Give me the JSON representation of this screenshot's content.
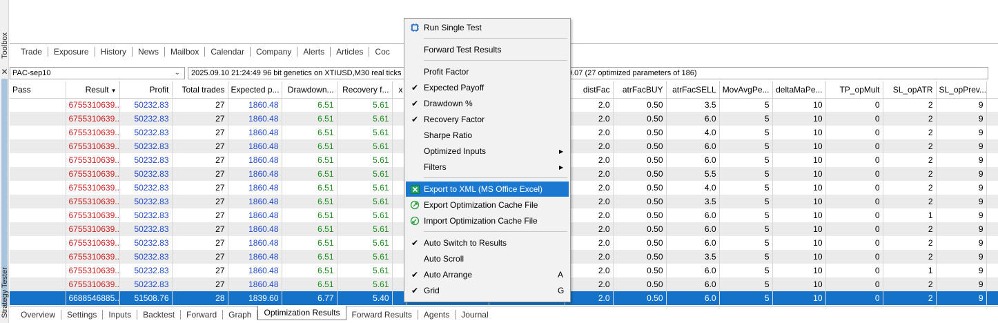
{
  "sidebar": {
    "toolbox_label": "Toolbox",
    "tester_label": "Strategy Tester",
    "close_symbol": "✕"
  },
  "toolbox_tabs": [
    "Trade",
    "Exposure",
    "History",
    "News",
    "Mailbox",
    "Calendar",
    "Company",
    "Alerts",
    "Articles",
    "Coc"
  ],
  "toolbar": {
    "profile": "PAC-sep10",
    "info": "2025.09.10 21:24:49   96 bit genetics  on XTIUSD,M30 real ticks",
    "info_right": "9.07  (27 optimized parameters of 186)"
  },
  "grid": {
    "headers": [
      "Pass",
      "Result",
      "Profit",
      "Total trades",
      "Expected p...",
      "Drawdown...",
      "Recovery f...",
      "x",
      "",
      "",
      "distFac",
      "atrFacBUY",
      "atrFacSELL",
      "MovAvgPe...",
      "deltaMaPe...",
      "TP_opMult",
      "SL_opATR",
      "SL_opPrev...",
      "("
    ],
    "sort_icon": "sort-desc-icon",
    "rows": [
      {
        "pass": "",
        "result": "6755310639...",
        "profit": "50232.83",
        "trades": "27",
        "expected": "1860.48",
        "drawdown": "6.51",
        "recovery": "5.61",
        "distFac": "2.0",
        "atrBuy": "0.50",
        "atrSell": "3.5",
        "movAvg": "5",
        "deltaMa": "10",
        "tpMult": "0",
        "slAtr": "2",
        "slPrev": "9"
      },
      {
        "pass": "",
        "result": "6755310639...",
        "profit": "50232.83",
        "trades": "27",
        "expected": "1860.48",
        "drawdown": "6.51",
        "recovery": "5.61",
        "distFac": "2.0",
        "atrBuy": "0.50",
        "atrSell": "6.0",
        "movAvg": "5",
        "deltaMa": "10",
        "tpMult": "0",
        "slAtr": "2",
        "slPrev": "9"
      },
      {
        "pass": "",
        "result": "6755310639...",
        "profit": "50232.83",
        "trades": "27",
        "expected": "1860.48",
        "drawdown": "6.51",
        "recovery": "5.61",
        "distFac": "2.0",
        "atrBuy": "0.50",
        "atrSell": "4.0",
        "movAvg": "5",
        "deltaMa": "10",
        "tpMult": "0",
        "slAtr": "2",
        "slPrev": "9"
      },
      {
        "pass": "",
        "result": "6755310639...",
        "profit": "50232.83",
        "trades": "27",
        "expected": "1860.48",
        "drawdown": "6.51",
        "recovery": "5.61",
        "distFac": "2.0",
        "atrBuy": "0.50",
        "atrSell": "6.0",
        "movAvg": "5",
        "deltaMa": "10",
        "tpMult": "0",
        "slAtr": "2",
        "slPrev": "9"
      },
      {
        "pass": "",
        "result": "6755310639...",
        "profit": "50232.83",
        "trades": "27",
        "expected": "1860.48",
        "drawdown": "6.51",
        "recovery": "5.61",
        "distFac": "2.0",
        "atrBuy": "0.50",
        "atrSell": "6.0",
        "movAvg": "5",
        "deltaMa": "10",
        "tpMult": "0",
        "slAtr": "2",
        "slPrev": "9"
      },
      {
        "pass": "",
        "result": "6755310639...",
        "profit": "50232.83",
        "trades": "27",
        "expected": "1860.48",
        "drawdown": "6.51",
        "recovery": "5.61",
        "distFac": "2.0",
        "atrBuy": "0.50",
        "atrSell": "5.5",
        "movAvg": "5",
        "deltaMa": "10",
        "tpMult": "0",
        "slAtr": "2",
        "slPrev": "9"
      },
      {
        "pass": "",
        "result": "6755310639...",
        "profit": "50232.83",
        "trades": "27",
        "expected": "1860.48",
        "drawdown": "6.51",
        "recovery": "5.61",
        "distFac": "2.0",
        "atrBuy": "0.50",
        "atrSell": "4.0",
        "movAvg": "5",
        "deltaMa": "10",
        "tpMult": "0",
        "slAtr": "2",
        "slPrev": "9"
      },
      {
        "pass": "",
        "result": "6755310639...",
        "profit": "50232.83",
        "trades": "27",
        "expected": "1860.48",
        "drawdown": "6.51",
        "recovery": "5.61",
        "distFac": "2.0",
        "atrBuy": "0.50",
        "atrSell": "3.5",
        "movAvg": "5",
        "deltaMa": "10",
        "tpMult": "0",
        "slAtr": "2",
        "slPrev": "9"
      },
      {
        "pass": "",
        "result": "6755310639...",
        "profit": "50232.83",
        "trades": "27",
        "expected": "1860.48",
        "drawdown": "6.51",
        "recovery": "5.61",
        "distFac": "2.0",
        "atrBuy": "0.50",
        "atrSell": "6.0",
        "movAvg": "5",
        "deltaMa": "10",
        "tpMult": "0",
        "slAtr": "1",
        "slPrev": "9"
      },
      {
        "pass": "",
        "result": "6755310639...",
        "profit": "50232.83",
        "trades": "27",
        "expected": "1860.48",
        "drawdown": "6.51",
        "recovery": "5.61",
        "distFac": "2.0",
        "atrBuy": "0.50",
        "atrSell": "6.0",
        "movAvg": "5",
        "deltaMa": "10",
        "tpMult": "0",
        "slAtr": "2",
        "slPrev": "9"
      },
      {
        "pass": "",
        "result": "6755310639...",
        "profit": "50232.83",
        "trades": "27",
        "expected": "1860.48",
        "drawdown": "6.51",
        "recovery": "5.61",
        "distFac": "2.0",
        "atrBuy": "0.50",
        "atrSell": "6.0",
        "movAvg": "5",
        "deltaMa": "10",
        "tpMult": "0",
        "slAtr": "2",
        "slPrev": "9"
      },
      {
        "pass": "",
        "result": "6755310639...",
        "profit": "50232.83",
        "trades": "27",
        "expected": "1860.48",
        "drawdown": "6.51",
        "recovery": "5.61",
        "distFac": "2.0",
        "atrBuy": "0.50",
        "atrSell": "3.5",
        "movAvg": "5",
        "deltaMa": "10",
        "tpMult": "0",
        "slAtr": "2",
        "slPrev": "9"
      },
      {
        "pass": "",
        "result": "6755310639...",
        "profit": "50232.83",
        "trades": "27",
        "expected": "1860.48",
        "drawdown": "6.51",
        "recovery": "5.61",
        "distFac": "2.0",
        "atrBuy": "0.50",
        "atrSell": "6.0",
        "movAvg": "5",
        "deltaMa": "10",
        "tpMult": "0",
        "slAtr": "1",
        "slPrev": "9"
      },
      {
        "pass": "",
        "result": "6755310639...",
        "profit": "50232.83",
        "trades": "27",
        "expected": "1860.48",
        "drawdown": "6.51",
        "recovery": "5.61",
        "distFac": "2.0",
        "atrBuy": "0.50",
        "atrSell": "6.0",
        "movAvg": "5",
        "deltaMa": "10",
        "tpMult": "0",
        "slAtr": "2",
        "slPrev": "9"
      },
      {
        "pass": "",
        "result": "6688546885...",
        "profit": "51508.76",
        "trades": "28",
        "expected": "1839.60",
        "drawdown": "6.77",
        "recovery": "5.40",
        "distFac": "2.0",
        "atrBuy": "0.50",
        "atrSell": "6.0",
        "movAvg": "5",
        "deltaMa": "10",
        "tpMult": "0",
        "slAtr": "2",
        "slPrev": "9",
        "selected": true
      }
    ]
  },
  "context_menu": {
    "items": [
      {
        "label": "Run Single Test",
        "icon": "chip-icon",
        "check": false
      },
      {
        "sep": true
      },
      {
        "label": "Forward Test Results",
        "check": false
      },
      {
        "sep": true
      },
      {
        "label": "Profit Factor",
        "check": false
      },
      {
        "label": "Expected Payoff",
        "check": true
      },
      {
        "label": "Drawdown %",
        "check": true
      },
      {
        "label": "Recovery Factor",
        "check": true
      },
      {
        "label": "Sharpe Ratio",
        "check": false
      },
      {
        "label": "Optimized Inputs",
        "check": false,
        "submenu": true
      },
      {
        "label": "Filters",
        "check": false,
        "submenu": true
      },
      {
        "sep": true
      },
      {
        "label": "Export to XML (MS Office Excel)",
        "icon": "excel-icon",
        "check": false,
        "highlighted": true
      },
      {
        "label": "Export Optimization Cache File",
        "icon": "export-cache-icon",
        "check": false
      },
      {
        "label": "Import Optimization Cache File",
        "icon": "import-cache-icon",
        "check": false
      },
      {
        "sep": true
      },
      {
        "label": "Auto Switch to Results",
        "check": true
      },
      {
        "label": "Auto Scroll",
        "check": false
      },
      {
        "label": "Auto Arrange",
        "check": true,
        "shortcut": "A"
      },
      {
        "label": "Grid",
        "check": true,
        "shortcut": "G"
      }
    ]
  },
  "bottom_tabs": [
    "Overview",
    "Settings",
    "Inputs",
    "Backtest",
    "Forward",
    "Graph",
    "Optimization Results",
    "Forward Results",
    "Agents",
    "Journal"
  ],
  "active_bottom_tab": "Optimization Results",
  "colors": {
    "selection": "#1473c8",
    "result_red": "#cc1f1f",
    "profit_blue": "#1f49c8",
    "drawdown_green": "#1b8a1b",
    "menu_highlight": "#1a78d0"
  }
}
